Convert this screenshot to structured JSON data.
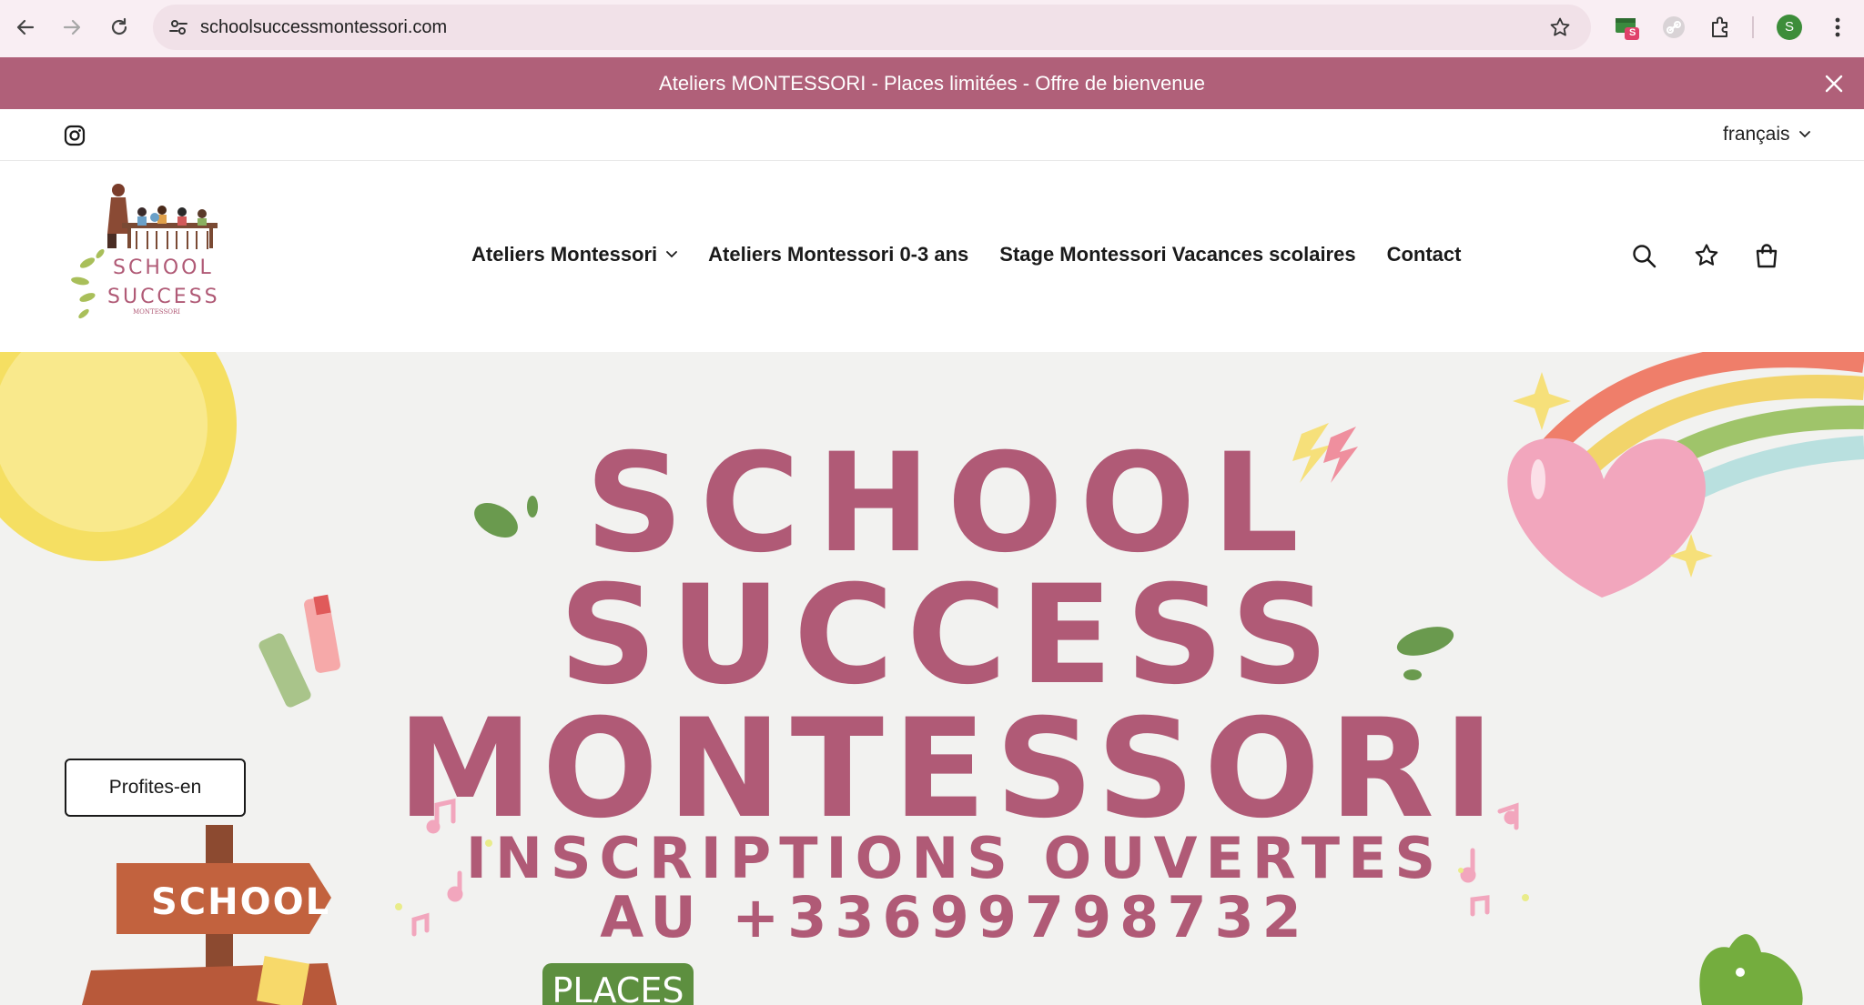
{
  "browser": {
    "url": "schoolsuccessmontessori.com",
    "avatar_letter": "S",
    "ext_badge": "S"
  },
  "announcement": {
    "text": "Ateliers MONTESSORI - Places limitées - Offre de bienvenue",
    "background": "#b06079"
  },
  "utility": {
    "language": "français"
  },
  "header": {
    "logo_line1": "SCHOOL",
    "logo_line2": "SUCCESS",
    "logo_line3": "MONTESSORI",
    "nav": [
      {
        "label": "Ateliers Montessori",
        "has_dropdown": true
      },
      {
        "label": "Ateliers Montessori 0-3 ans"
      },
      {
        "label": "Stage Montessori Vacances scolaires"
      },
      {
        "label": "Contact"
      }
    ]
  },
  "hero": {
    "line1": "SCHOOL",
    "line2": "SUCCESS",
    "line3": "MONTESSORI",
    "line4": "INSCRIPTIONS OUVERTES",
    "line5": "AU +33699798732",
    "places": "PLACES",
    "sign": "SCHOOL",
    "cta": "Profites-en",
    "title_color": "#b05a76"
  }
}
